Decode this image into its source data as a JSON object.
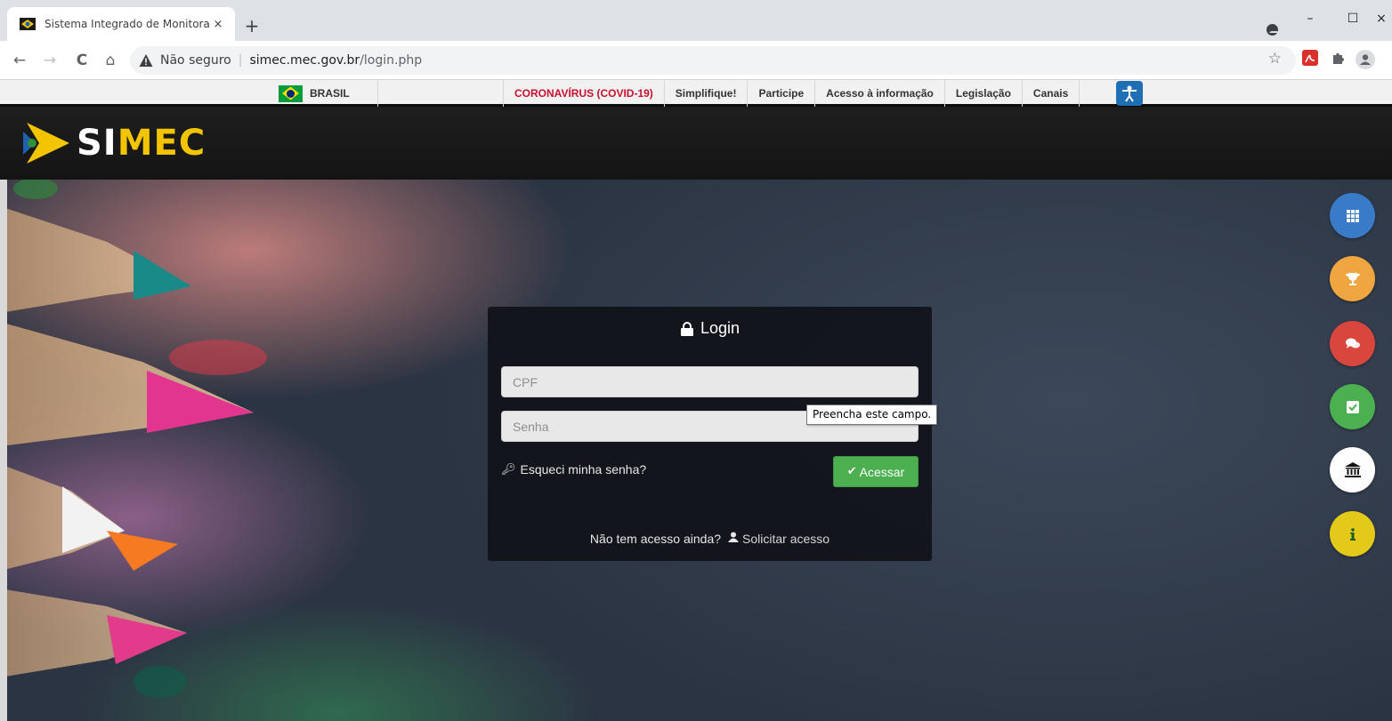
{
  "browser": {
    "tab_title": "Sistema Integrado de Monitoram",
    "tab_close": "×",
    "new_tab": "+",
    "window_minimize": "–",
    "window_maximize": "☐",
    "window_close": "×",
    "nav_back": "←",
    "nav_forward": "→",
    "nav_reload": "C",
    "nav_home": "⌂",
    "security_label": "Não seguro",
    "separator": "|",
    "url_domain": "simec.mec.gov.br",
    "url_path": "/login.php",
    "bookmark_star": "☆"
  },
  "gov_bar": {
    "brasil_label": "BRASIL",
    "links": [
      "CORONAVÍRUS (COVID-19)",
      "Simplifique!",
      "Participe",
      "Acesso à informação",
      "Legislação",
      "Canais"
    ]
  },
  "header": {
    "logo_si": "SI",
    "logo_mec": "MEC"
  },
  "login": {
    "title": "Login",
    "cpf_placeholder": "CPF",
    "password_placeholder": "Senha",
    "forgot_label": "Esqueci minha senha?",
    "submit_label": "Acessar",
    "no_access_label": "Não tem acesso ainda?",
    "request_access_label": "Solicitar acesso",
    "validation_tooltip": "Preencha este campo."
  },
  "side_buttons": [
    {
      "icon": "grid-icon",
      "color": "#3a7bc8"
    },
    {
      "icon": "trophy-icon",
      "color": "#f0a640"
    },
    {
      "icon": "chat-icon",
      "color": "#d9463d"
    },
    {
      "icon": "checkbox-icon",
      "color": "#4caf50"
    },
    {
      "icon": "institution-icon",
      "color": "#ffffff"
    },
    {
      "icon": "info-icon",
      "color": "#e3c91a"
    }
  ],
  "colors": {
    "covid_red": "#c8102e",
    "logo_yellow": "#f2c500",
    "submit_green": "#4caf50"
  }
}
